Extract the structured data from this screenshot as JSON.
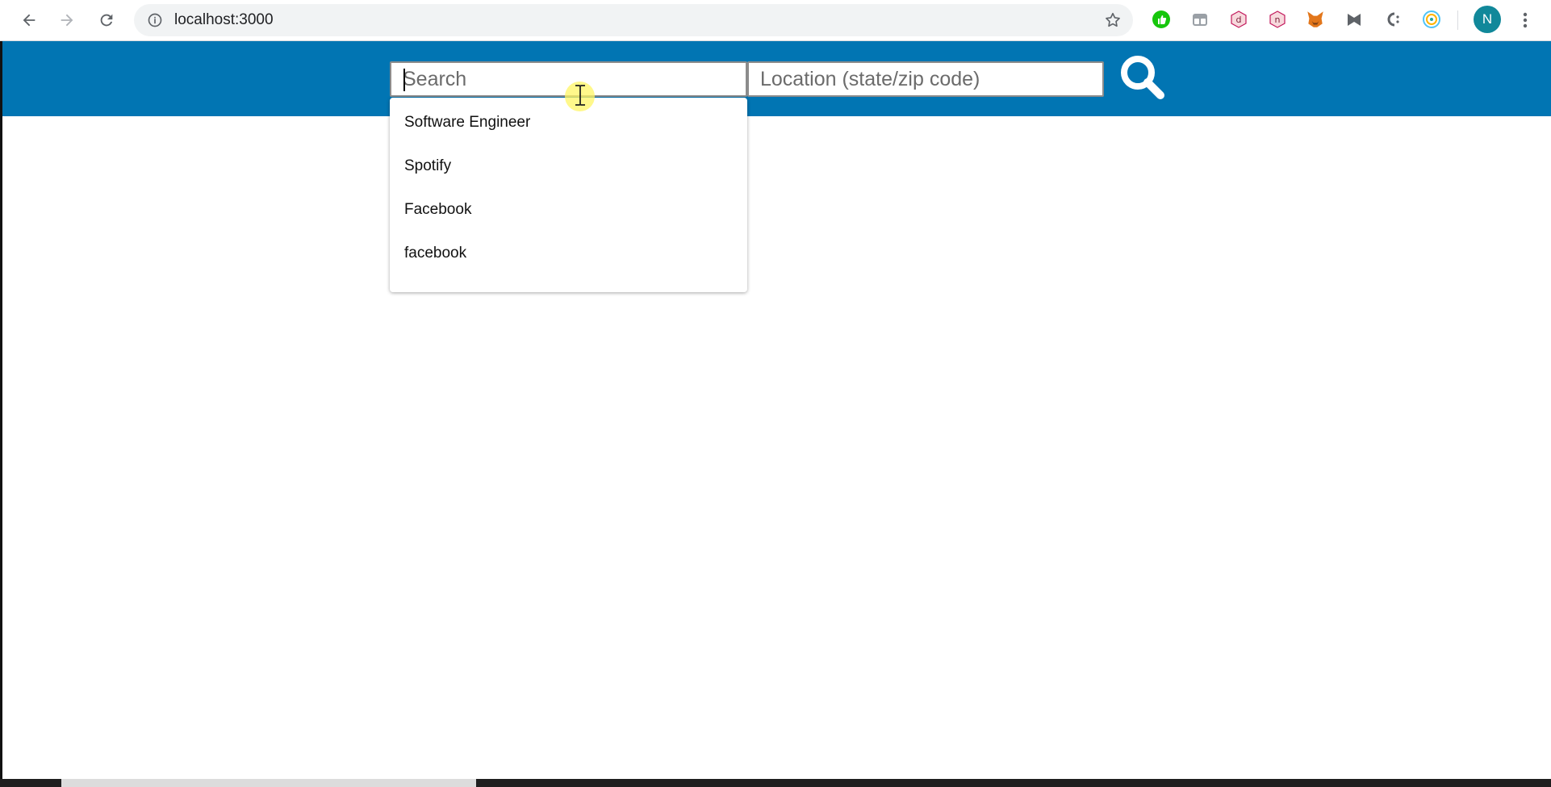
{
  "browser": {
    "url": "localhost:3000",
    "profile_initial": "N",
    "extensions": [
      "green-thumb-icon",
      "tabs-icon",
      "d-hex-icon",
      "n-hex-icon",
      "metamask-fox-icon",
      "bookmark-flag-icon",
      "c-dots-icon",
      "radar-icon"
    ]
  },
  "header": {
    "background": "#0175b3",
    "search": {
      "placeholder": "Search",
      "value": ""
    },
    "location": {
      "placeholder": "Location (state/zip code)",
      "value": ""
    }
  },
  "dropdown": {
    "items": [
      "Software Engineer",
      "Spotify",
      "Facebook",
      "facebook"
    ]
  }
}
